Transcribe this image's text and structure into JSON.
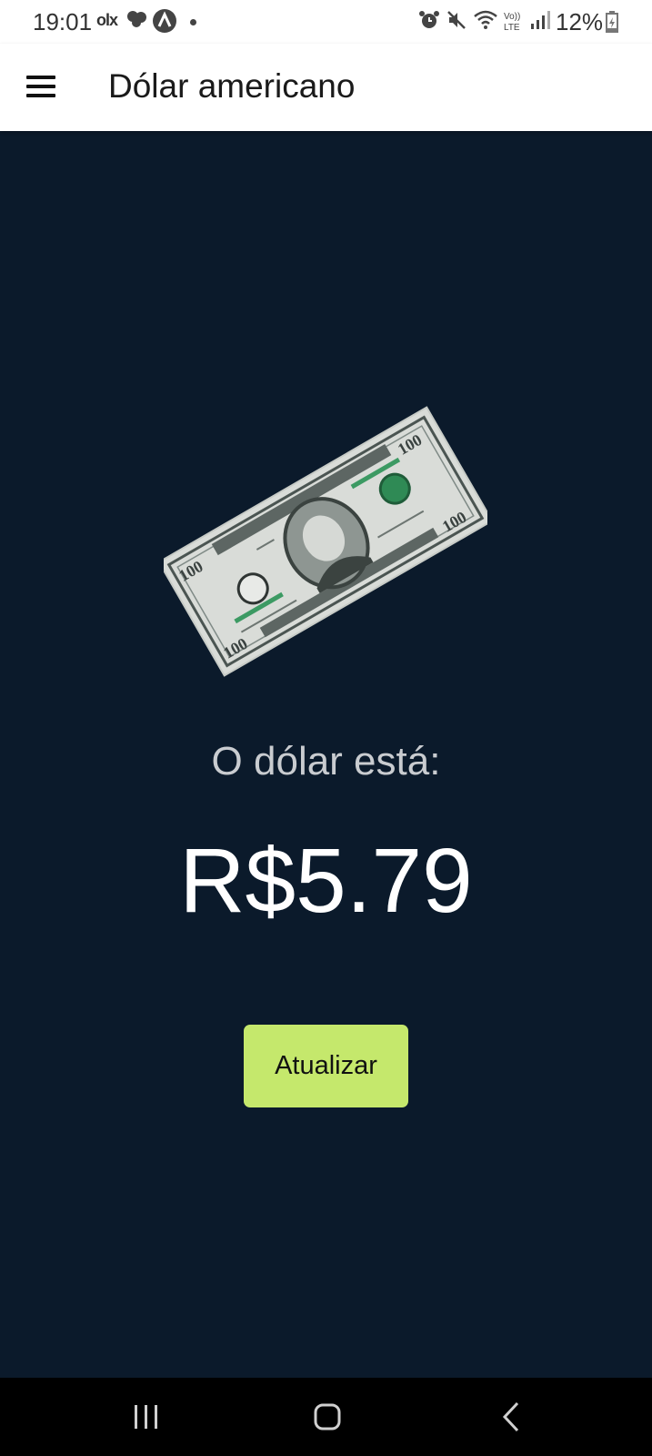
{
  "status_bar": {
    "time": "19:01",
    "olx_label": "olx",
    "battery": "12%",
    "icons": [
      "olx-icon",
      "whatsapp-like-icon",
      "a-app-icon",
      "notification-dot",
      "alarm-icon",
      "mute-icon",
      "wifi-icon",
      "volte-icon",
      "signal-icon",
      "battery-icon"
    ]
  },
  "app_bar": {
    "title": "Dólar americano",
    "menu_icon": "hamburger-menu-icon"
  },
  "main": {
    "image": "hundred-dollar-bill",
    "label": "O dólar está:",
    "price": "R$5.79",
    "refresh_label": "Atualizar"
  },
  "nav_bar": {
    "icons": [
      "recent-apps-icon",
      "home-icon",
      "back-icon"
    ]
  },
  "colors": {
    "background": "#0b1a2b",
    "accent_button": "#c5e86c",
    "appbar": "#ffffff"
  }
}
